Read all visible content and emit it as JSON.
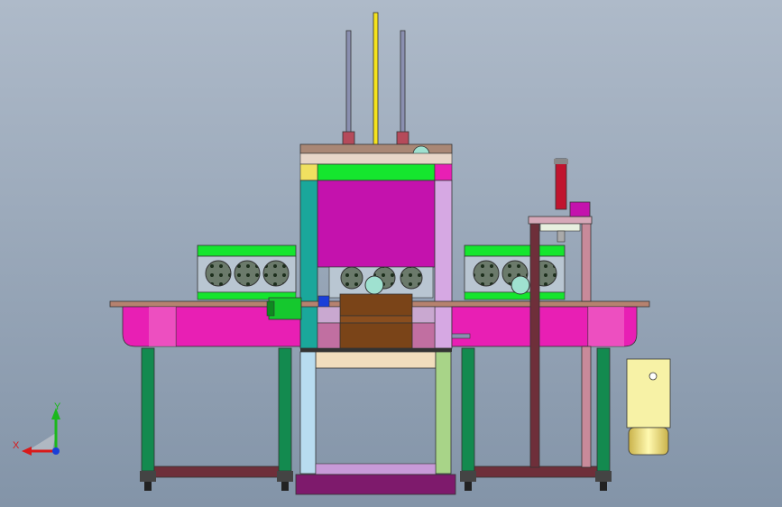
{
  "viewport": {
    "background_top": "#aebac9",
    "background_bottom": "#8394a8"
  },
  "colors": {
    "magenta": "#e81fb4",
    "magenta_dark": "#b0158a",
    "purple_plate": "#c412ad",
    "green_bright": "#15e62e",
    "green_dark": "#138a4f",
    "teal": "#1aa79b",
    "lavender": "#d6a8e3",
    "brown": "#7a4418",
    "tan": "#f1ddbd",
    "maroon": "#6e2f3a",
    "rod_gray": "#8a8fb0",
    "rod_yellow": "#f5e31d",
    "pale_yellow": "#f7f2a6",
    "cyan": "#9fe1d0"
  },
  "triad": {
    "x_label": "X",
    "y_label": "Y",
    "x_color": "#d91a1a",
    "y_color": "#1bb81b",
    "z_color": "#1a3fd9"
  }
}
